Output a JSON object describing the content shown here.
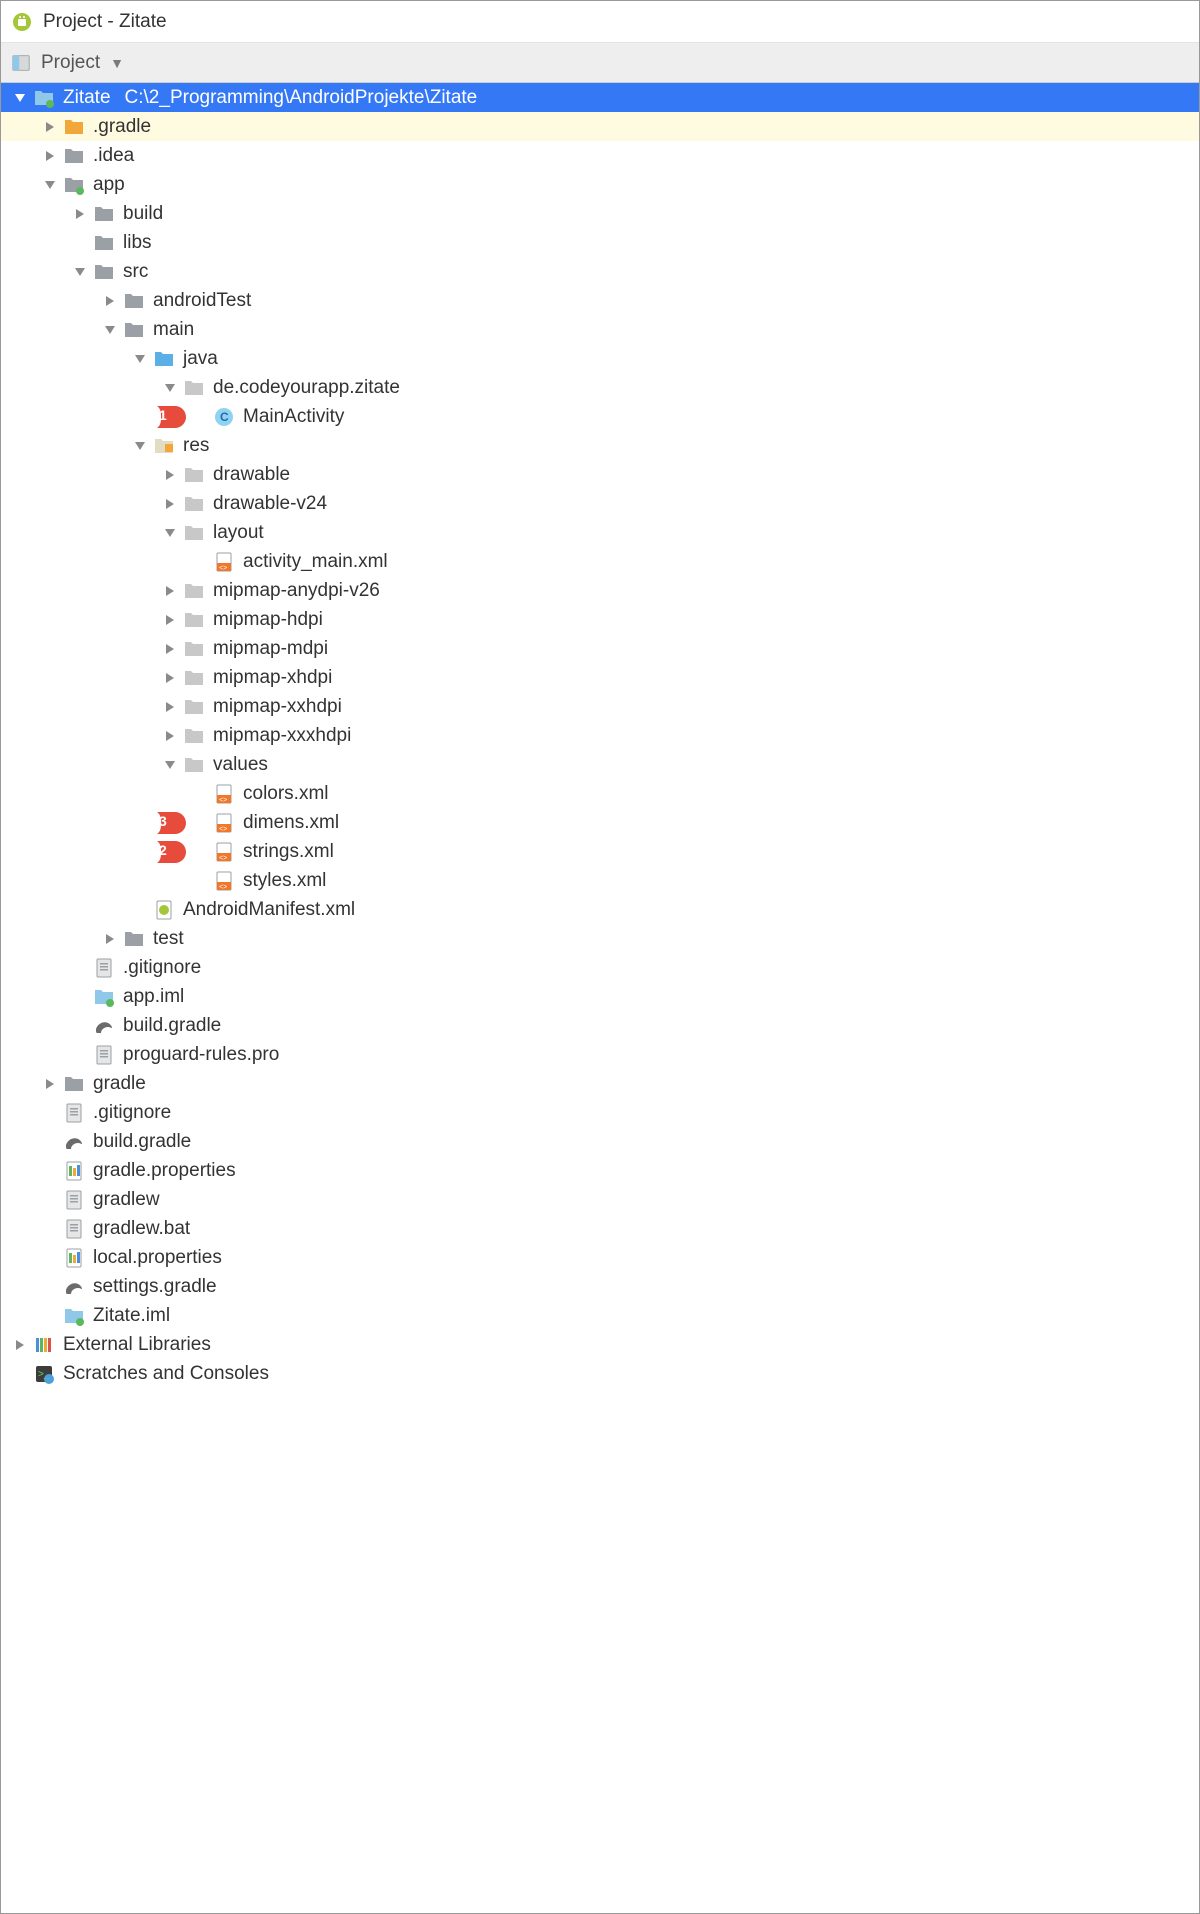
{
  "title": "Project - Zitate",
  "toolbar": {
    "view_label": "Project"
  },
  "root": {
    "name": "Zitate",
    "path": "C:\\2_Programming\\AndroidProjekte\\Zitate"
  },
  "nodes": {
    "gradle_hidden": ".gradle",
    "idea": ".idea",
    "app": "app",
    "build": "build",
    "libs": "libs",
    "src": "src",
    "androidTest": "androidTest",
    "main": "main",
    "java": "java",
    "pkg": "de.codeyourapp.zitate",
    "mainActivity": "MainActivity",
    "res": "res",
    "drawable": "drawable",
    "drawable_v24": "drawable-v24",
    "layout": "layout",
    "activity_main": "activity_main.xml",
    "mip_anydpi": "mipmap-anydpi-v26",
    "mip_hdpi": "mipmap-hdpi",
    "mip_mdpi": "mipmap-mdpi",
    "mip_xhdpi": "mipmap-xhdpi",
    "mip_xxhdpi": "mipmap-xxhdpi",
    "mip_xxxhdpi": "mipmap-xxxhdpi",
    "values": "values",
    "colors_xml": "colors.xml",
    "dimens_xml": "dimens.xml",
    "strings_xml": "strings.xml",
    "styles_xml": "styles.xml",
    "manifest": "AndroidManifest.xml",
    "test": "test",
    "gitignore_app": ".gitignore",
    "app_iml": "app.iml",
    "build_gradle_app": "build.gradle",
    "proguard": "proguard-rules.pro",
    "gradle_dir": "gradle",
    "gitignore_root": ".gitignore",
    "build_gradle_root": "build.gradle",
    "gradle_props": "gradle.properties",
    "gradlew": "gradlew",
    "gradlew_bat": "gradlew.bat",
    "local_props": "local.properties",
    "settings_gradle": "settings.gradle",
    "zitate_iml": "Zitate.iml",
    "ext_libs": "External Libraries",
    "scratches": "Scratches and Consoles"
  },
  "markers": {
    "m1": "1",
    "m2": "2",
    "m3": "3"
  }
}
